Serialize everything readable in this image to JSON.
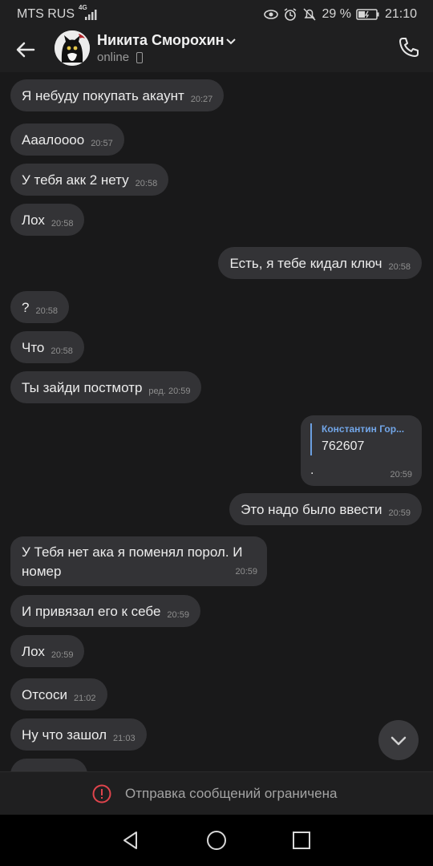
{
  "status_bar": {
    "carrier": "MTS RUS",
    "network": "4G",
    "battery": "29 %",
    "time": "21:10"
  },
  "header": {
    "contact_name": "Никита Сморохин",
    "status": "online"
  },
  "messages": [
    {
      "text": "Я небуду покупать акаунт",
      "time": "20:27",
      "side": "left"
    },
    {
      "text": "Аaалоооо",
      "time": "20:57",
      "side": "left"
    },
    {
      "text": "У тебя акк 2 нету",
      "time": "20:58",
      "side": "left"
    },
    {
      "text": "Лох",
      "time": "20:58",
      "side": "left"
    },
    {
      "text": "Есть, я тебе кидал ключ",
      "time": "20:58",
      "side": "right"
    },
    {
      "text": "?",
      "time": "20:58",
      "side": "left"
    },
    {
      "text": "Что",
      "time": "20:58",
      "side": "left"
    },
    {
      "text": "Ты зайди постмотр",
      "time": "ред. 20:59",
      "side": "left"
    },
    {
      "text": "Это надо было ввести",
      "time": "20:59",
      "side": "right"
    },
    {
      "text": "У Тебя нет ака я поменял порол. И номер",
      "time": "20:59",
      "side": "left"
    },
    {
      "text": "И привязал его к себе",
      "time": "20:59",
      "side": "left"
    },
    {
      "text": "Лох",
      "time": "20:59",
      "side": "left"
    },
    {
      "text": "Отсоси",
      "time": "21:02",
      "side": "left"
    },
    {
      "text": "Ну что зашол",
      "time": "21:03",
      "side": "left"
    }
  ],
  "reply_message": {
    "author": "Константин Гор...",
    "quote": "762607",
    "body": ".",
    "time": "20:59"
  },
  "restricted": {
    "text": "Отправка сообщений ограничена"
  }
}
